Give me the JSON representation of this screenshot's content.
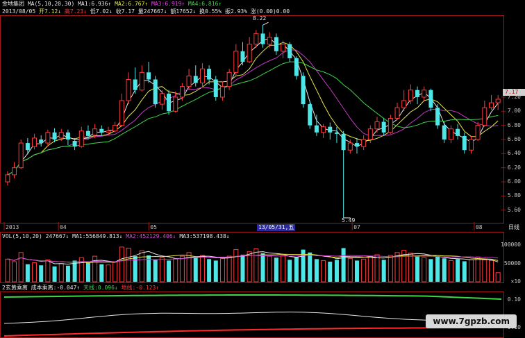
{
  "header": {
    "line1": [
      {
        "text": "金地集团",
        "color": "white"
      },
      {
        "text": "MA(5,10,20,30)",
        "color": "white"
      },
      {
        "text": "MA1:6.936↑",
        "color": "white"
      },
      {
        "text": "MA2:6.767↑",
        "color": "yellow"
      },
      {
        "text": "MA3:6.919↑",
        "color": "magenta"
      },
      {
        "text": "MA4:6.816↑",
        "color": "green"
      }
    ],
    "line2": [
      {
        "text": "2013/08/05",
        "color": "white"
      },
      {
        "text": "开7.12↓",
        "color": "yellow"
      },
      {
        "text": "高7.23↓",
        "color": "red"
      },
      {
        "text": "低7.02↓",
        "color": "white"
      },
      {
        "text": "收7.17",
        "color": "white"
      },
      {
        "text": "量247667↓",
        "color": "white"
      },
      {
        "text": "额17652↓",
        "color": "white"
      },
      {
        "text": "换0.55%",
        "color": "white"
      },
      {
        "text": "振2.93%",
        "color": "white"
      },
      {
        "text": "涨(0.00)0.00",
        "color": "white"
      }
    ]
  },
  "price_axis": [
    "7.20",
    "7.00",
    "6.80",
    "6.60",
    "6.40",
    "6.20",
    "6.00",
    "5.80",
    "5.60"
  ],
  "price_tag": "7.17",
  "annotations": {
    "high": "8.22",
    "low": "5.49"
  },
  "date_axis": [
    "2013",
    "04",
    "05",
    "07",
    "08"
  ],
  "highlight_date": "13/05/31,五",
  "period": "日线",
  "vol_header": {
    "label": "VOL(5,10,20)",
    "vol": "247667↓",
    "ma1": "MA1:556849.813↓",
    "ma2": "MA2:452129.406↓",
    "ma3": "MA3:537198.438↓"
  },
  "vol_axis": [
    "100000",
    "50000",
    "×10"
  ],
  "ind_header": {
    "name": "2玄黄乘离",
    "cost": "成本乘离:-0.047↑",
    "sky": "天线:0.096↓",
    "earth": "地线:-0.123↑"
  },
  "ind_axis": [
    "0.10",
    "-0.10"
  ],
  "watermark": "www.7gpzb.com",
  "chart_data": {
    "type": "candlestick",
    "candles": [
      {
        "o": 6.0,
        "c": 6.1,
        "h": 6.15,
        "l": 5.95
      },
      {
        "o": 6.1,
        "c": 6.2,
        "h": 6.28,
        "l": 6.05
      },
      {
        "o": 6.2,
        "c": 6.55,
        "h": 6.6,
        "l": 6.18
      },
      {
        "o": 6.55,
        "c": 6.45,
        "h": 6.62,
        "l": 6.4
      },
      {
        "o": 6.5,
        "c": 6.62,
        "h": 6.68,
        "l": 6.46
      },
      {
        "o": 6.6,
        "c": 6.55,
        "h": 6.66,
        "l": 6.5
      },
      {
        "o": 6.55,
        "c": 6.7,
        "h": 6.74,
        "l": 6.5
      },
      {
        "o": 6.7,
        "c": 6.6,
        "h": 6.76,
        "l": 6.56
      },
      {
        "o": 6.62,
        "c": 6.7,
        "h": 6.75,
        "l": 6.58
      },
      {
        "o": 6.7,
        "c": 6.6,
        "h": 6.74,
        "l": 6.52
      },
      {
        "o": 6.58,
        "c": 6.5,
        "h": 6.62,
        "l": 6.45
      },
      {
        "o": 6.5,
        "c": 6.72,
        "h": 6.78,
        "l": 6.48
      },
      {
        "o": 6.72,
        "c": 6.65,
        "h": 6.8,
        "l": 6.6
      },
      {
        "o": 6.66,
        "c": 6.75,
        "h": 6.82,
        "l": 6.62
      },
      {
        "o": 6.75,
        "c": 6.7,
        "h": 6.8,
        "l": 6.66
      },
      {
        "o": 6.7,
        "c": 6.72,
        "h": 6.78,
        "l": 6.66
      },
      {
        "o": 6.72,
        "c": 6.8,
        "h": 6.85,
        "l": 6.7
      },
      {
        "o": 6.8,
        "c": 7.15,
        "h": 7.25,
        "l": 6.78
      },
      {
        "o": 7.15,
        "c": 7.45,
        "h": 7.55,
        "l": 7.1
      },
      {
        "o": 7.45,
        "c": 7.3,
        "h": 7.62,
        "l": 7.25
      },
      {
        "o": 7.3,
        "c": 7.55,
        "h": 7.65,
        "l": 7.28
      },
      {
        "o": 7.55,
        "c": 7.45,
        "h": 7.7,
        "l": 7.4
      },
      {
        "o": 7.45,
        "c": 7.1,
        "h": 7.5,
        "l": 7.05
      },
      {
        "o": 7.1,
        "c": 7.25,
        "h": 7.3,
        "l": 7.02
      },
      {
        "o": 7.25,
        "c": 7.0,
        "h": 7.3,
        "l": 6.95
      },
      {
        "o": 7.0,
        "c": 7.2,
        "h": 7.28,
        "l": 6.98
      },
      {
        "o": 7.2,
        "c": 7.35,
        "h": 7.4,
        "l": 7.15
      },
      {
        "o": 7.35,
        "c": 7.5,
        "h": 7.6,
        "l": 7.3
      },
      {
        "o": 7.5,
        "c": 7.4,
        "h": 7.65,
        "l": 7.35
      },
      {
        "o": 7.4,
        "c": 7.6,
        "h": 7.68,
        "l": 7.35
      },
      {
        "o": 7.6,
        "c": 7.45,
        "h": 7.65,
        "l": 7.38
      },
      {
        "o": 7.45,
        "c": 7.2,
        "h": 7.5,
        "l": 7.15
      },
      {
        "o": 7.2,
        "c": 7.35,
        "h": 7.42,
        "l": 7.15
      },
      {
        "o": 7.35,
        "c": 7.55,
        "h": 7.6,
        "l": 7.3
      },
      {
        "o": 7.55,
        "c": 7.85,
        "h": 7.95,
        "l": 7.5
      },
      {
        "o": 7.85,
        "c": 7.7,
        "h": 7.98,
        "l": 7.65
      },
      {
        "o": 7.7,
        "c": 7.95,
        "h": 8.05,
        "l": 7.68
      },
      {
        "o": 7.95,
        "c": 8.1,
        "h": 8.15,
        "l": 7.9
      },
      {
        "o": 8.1,
        "c": 7.95,
        "h": 8.22,
        "l": 7.9
      },
      {
        "o": 7.95,
        "c": 8.05,
        "h": 8.12,
        "l": 7.9
      },
      {
        "o": 8.05,
        "c": 7.85,
        "h": 8.1,
        "l": 7.8
      },
      {
        "o": 7.85,
        "c": 7.95,
        "h": 8.0,
        "l": 7.75
      },
      {
        "o": 7.95,
        "c": 7.75,
        "h": 7.98,
        "l": 7.7
      },
      {
        "o": 7.75,
        "c": 7.5,
        "h": 7.78,
        "l": 7.45
      },
      {
        "o": 7.5,
        "c": 7.1,
        "h": 7.55,
        "l": 7.05
      },
      {
        "o": 7.1,
        "c": 6.8,
        "h": 7.15,
        "l": 6.75
      },
      {
        "o": 6.8,
        "c": 6.7,
        "h": 6.95,
        "l": 6.65
      },
      {
        "o": 6.7,
        "c": 6.78,
        "h": 6.82,
        "l": 6.62
      },
      {
        "o": 6.78,
        "c": 6.7,
        "h": 6.84,
        "l": 6.6
      },
      {
        "o": 6.7,
        "c": 6.68,
        "h": 6.78,
        "l": 6.55
      },
      {
        "o": 6.68,
        "c": 6.45,
        "h": 6.72,
        "l": 5.49
      },
      {
        "o": 6.45,
        "c": 6.55,
        "h": 6.6,
        "l": 6.4
      },
      {
        "o": 6.55,
        "c": 6.5,
        "h": 6.62,
        "l": 6.4
      },
      {
        "o": 6.5,
        "c": 6.6,
        "h": 6.66,
        "l": 6.45
      },
      {
        "o": 6.6,
        "c": 6.75,
        "h": 6.8,
        "l": 6.55
      },
      {
        "o": 6.75,
        "c": 6.85,
        "h": 6.92,
        "l": 6.7
      },
      {
        "o": 6.85,
        "c": 6.7,
        "h": 6.9,
        "l": 6.65
      },
      {
        "o": 6.7,
        "c": 6.9,
        "h": 6.95,
        "l": 6.68
      },
      {
        "o": 6.9,
        "c": 7.05,
        "h": 7.12,
        "l": 6.88
      },
      {
        "o": 7.05,
        "c": 7.15,
        "h": 7.3,
        "l": 7.0
      },
      {
        "o": 7.15,
        "c": 7.3,
        "h": 7.38,
        "l": 7.1
      },
      {
        "o": 7.3,
        "c": 7.2,
        "h": 7.35,
        "l": 7.1
      },
      {
        "o": 7.2,
        "c": 7.3,
        "h": 7.35,
        "l": 7.15
      },
      {
        "o": 7.3,
        "c": 7.05,
        "h": 7.32,
        "l": 7.0
      },
      {
        "o": 7.05,
        "c": 6.8,
        "h": 7.1,
        "l": 6.75
      },
      {
        "o": 6.8,
        "c": 6.6,
        "h": 6.85,
        "l": 6.55
      },
      {
        "o": 6.6,
        "c": 6.75,
        "h": 6.8,
        "l": 6.55
      },
      {
        "o": 6.75,
        "c": 6.65,
        "h": 6.82,
        "l": 6.6
      },
      {
        "o": 6.65,
        "c": 6.45,
        "h": 6.7,
        "l": 6.4
      },
      {
        "o": 6.45,
        "c": 6.6,
        "h": 6.65,
        "l": 6.4
      },
      {
        "o": 6.6,
        "c": 6.8,
        "h": 6.85,
        "l": 6.58
      },
      {
        "o": 6.8,
        "c": 7.05,
        "h": 7.15,
        "l": 6.78
      },
      {
        "o": 7.05,
        "c": 7.12,
        "h": 7.23,
        "l": 7.02
      },
      {
        "o": 7.12,
        "c": 7.17,
        "h": 7.23,
        "l": 7.02
      }
    ],
    "volume": [
      62,
      55,
      80,
      48,
      52,
      45,
      60,
      42,
      50,
      44,
      58,
      66,
      52,
      70,
      48,
      46,
      55,
      95,
      92,
      70,
      85,
      72,
      60,
      66,
      58,
      62,
      70,
      80,
      66,
      72,
      62,
      58,
      64,
      70,
      88,
      74,
      82,
      90,
      78,
      70,
      66,
      72,
      60,
      68,
      88,
      80,
      62,
      58,
      55,
      60,
      92,
      64,
      58,
      62,
      70,
      74,
      60,
      72,
      80,
      86,
      78,
      70,
      66,
      62,
      70,
      64,
      58,
      62,
      56,
      60,
      68,
      60,
      58,
      25
    ],
    "ylim": [
      5.45,
      8.3
    ]
  }
}
